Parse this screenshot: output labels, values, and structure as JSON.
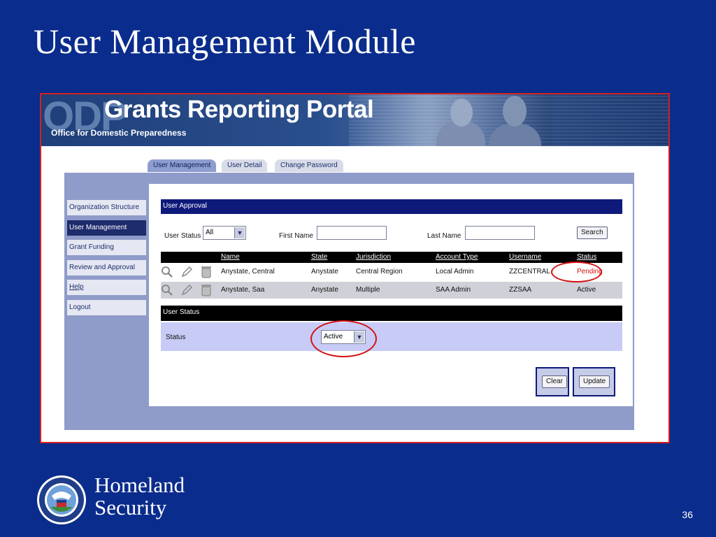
{
  "slide": {
    "title": "User Management Module",
    "page_number": "36",
    "org_name_line1": "Homeland",
    "org_name_line2": "Security"
  },
  "banner": {
    "logo_text": "ODP",
    "app_title": "Grants Reporting Portal",
    "subtitle": "Office for Domestic Preparedness"
  },
  "tabs": [
    {
      "label": "User Management",
      "active": true
    },
    {
      "label": "User Detail",
      "active": false
    },
    {
      "label": "Change Password",
      "active": false
    }
  ],
  "nav": {
    "items": [
      {
        "label": "Organization Structure"
      },
      {
        "label": "User Management",
        "active": true
      },
      {
        "label": "Grant Funding"
      },
      {
        "label": "Review and Approval"
      },
      {
        "label": "Help"
      },
      {
        "label": "Logout"
      }
    ]
  },
  "approval": {
    "section_title": "User Approval",
    "user_status_label": "User Status",
    "user_status_value": "All",
    "first_name_label": "First Name",
    "first_name_value": "",
    "last_name_label": "Last Name",
    "last_name_value": "",
    "search_label": "Search",
    "columns": [
      "Name",
      "State",
      "Jurisdiction",
      "Account Type",
      "Username",
      "Status"
    ],
    "rows": [
      {
        "name": "Anystate, Central",
        "state": "Anystate",
        "jurisdiction": "Central Region",
        "account_type": "Local Admin",
        "username": "ZZCENTRAL",
        "status": "Pending"
      },
      {
        "name": "Anystate, Saa",
        "state": "Anystate",
        "jurisdiction": "Multiple",
        "account_type": "SAA Admin",
        "username": "ZZSAA",
        "status": "Active"
      }
    ]
  },
  "status_section": {
    "section_title": "User Status",
    "status_label": "Status",
    "status_value": "Active",
    "clear_label": "Clear",
    "update_label": "Update"
  },
  "colors": {
    "slide_bg": "#0a2c8c",
    "section_bar": "#0e1a7a",
    "highlight_ellipse": "#d41010",
    "pending_text": "#d41010"
  }
}
